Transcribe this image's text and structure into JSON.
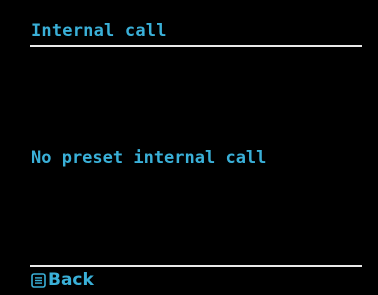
{
  "header": {
    "title": "Internal call"
  },
  "main": {
    "message": "No preset internal call"
  },
  "footer": {
    "back_icon": "menu-list-icon",
    "back_label": "Back"
  },
  "colors": {
    "background": "#000000",
    "text": "#3ab0d8",
    "divider": "#e8e8e8"
  }
}
